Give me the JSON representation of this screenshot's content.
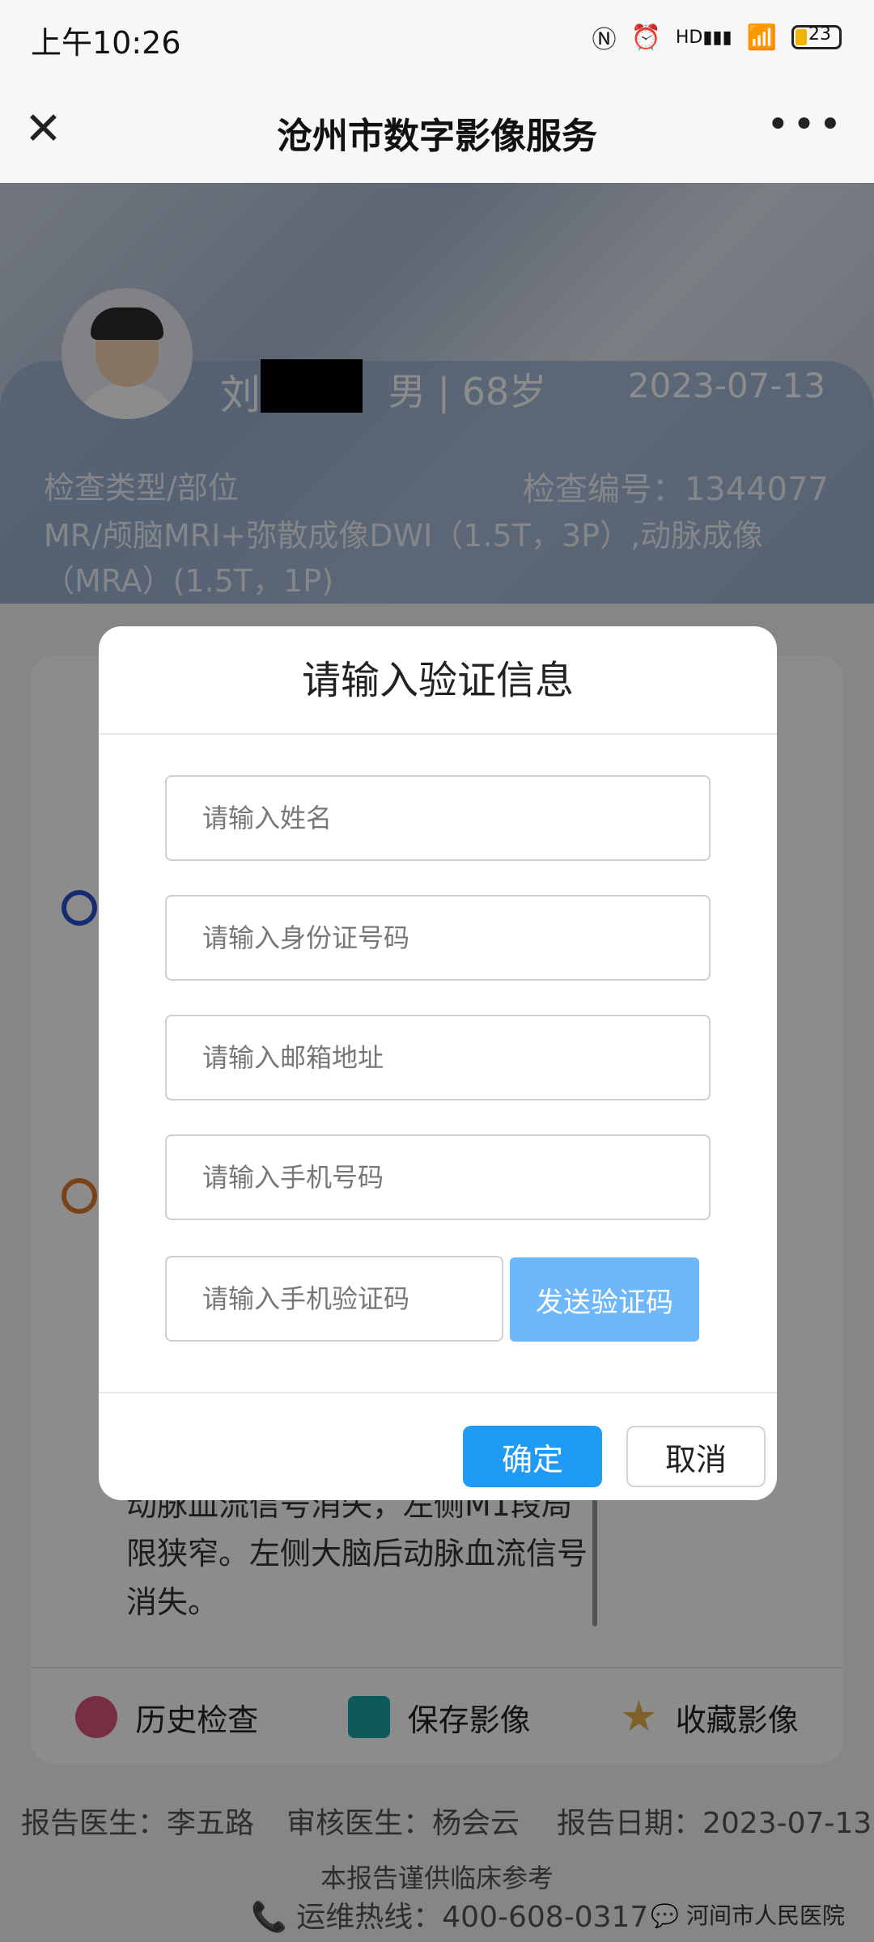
{
  "status_bar": {
    "time": "上午10:26",
    "network": "HD",
    "battery": "23"
  },
  "header": {
    "title": "沧州市数字影像服务"
  },
  "patient": {
    "name_visible": "刘",
    "gender_age": "男 | 68岁",
    "date": "2023-07-13",
    "exam_type_label": "检查类型/部位",
    "exam_no": "检查编号：1344077",
    "exam_desc": "MR/颅脑MRI+弥散成像DWI（1.5T，3P）,动脉成像（MRA）(1.5T，1P)"
  },
  "background": {
    "report_text": "动脉血流信号消失，左侧M1段局限狭窄。左侧大脑后动脉血流信号消失。",
    "nav": [
      {
        "label": "历史检查",
        "icon": "clock-icon",
        "color": "#d9557a"
      },
      {
        "label": "保存影像",
        "icon": "save-icon",
        "color": "#1aa3a3"
      },
      {
        "label": "收藏影像",
        "icon": "star-icon",
        "color": "#e8b04a"
      }
    ],
    "footer": {
      "report_doctor": "报告医生：李五路",
      "review_doctor": "审核医生：杨会云",
      "report_date": "报告日期：2023-07-13",
      "disclaimer": "本报告谨供临床参考",
      "hotline": "运维热线：400-608-0317",
      "wechat_account": "河间市人民医院"
    }
  },
  "dialog": {
    "title": "请输入验证信息",
    "fields": {
      "name_placeholder": "请输入姓名",
      "id_placeholder": "请输入身份证号码",
      "email_placeholder": "请输入邮箱地址",
      "phone_placeholder": "请输入手机号码",
      "code_placeholder": "请输入手机验证码"
    },
    "send_code_label": "发送验证码",
    "confirm_label": "确定",
    "cancel_label": "取消"
  },
  "colors": {
    "accent": "#1f9bf5",
    "send_button": "#6fb7fb"
  }
}
